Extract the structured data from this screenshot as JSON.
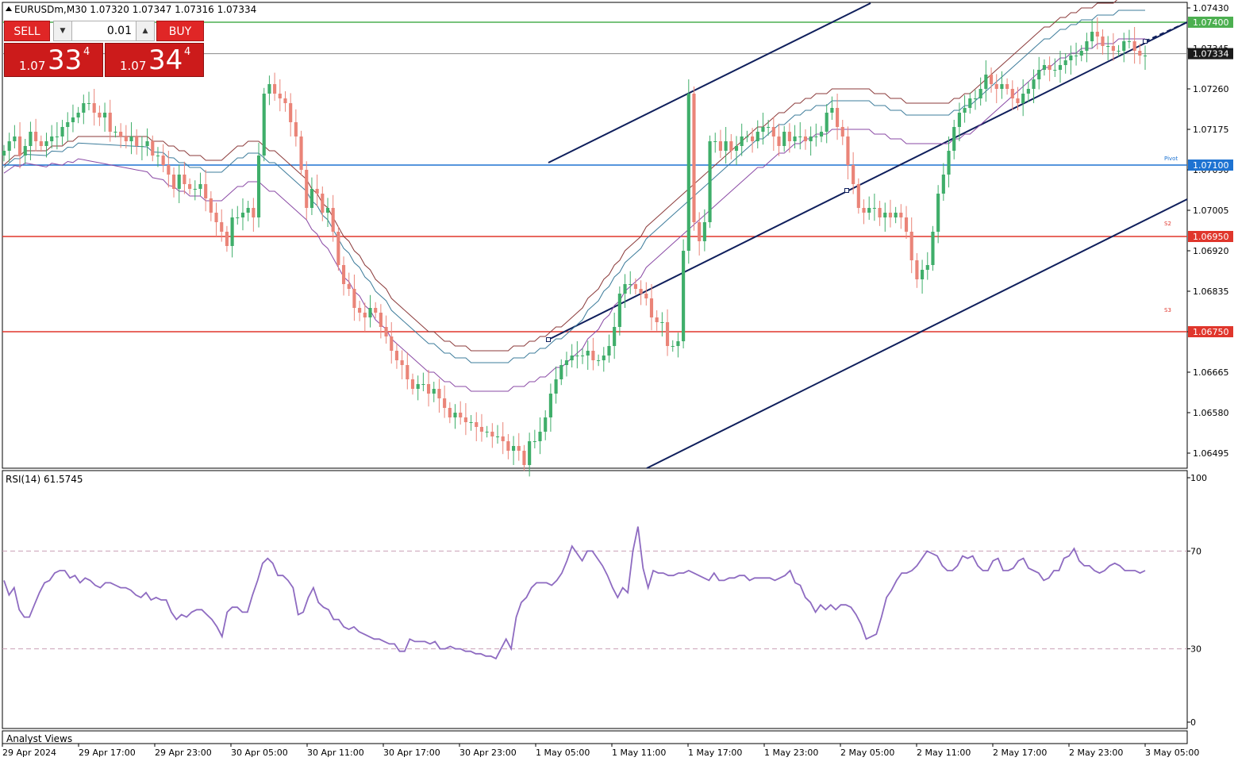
{
  "header": {
    "symbol_info": "EURUSDm,M30  1.07320 1.07347 1.07316 1.07334"
  },
  "trade_panel": {
    "sell_label": "SELL",
    "buy_label": "BUY",
    "lot": "0.01",
    "bid_prefix": "1.07",
    "bid_big": "33",
    "bid_sup": "4",
    "ask_prefix": "1.07",
    "ask_big": "34",
    "ask_sup": "4"
  },
  "price_axis": {
    "ticks": [
      "1.07430",
      "1.07345",
      "1.07260",
      "1.07175",
      "1.07090",
      "1.07005",
      "1.06920",
      "1.06835",
      "1.06750",
      "1.06665",
      "1.06580",
      "1.06495"
    ],
    "ylim": [
      1.06465,
      1.0744
    ],
    "current_price": "1.07334"
  },
  "levels": [
    {
      "value": 1.074,
      "label": "1.07400",
      "color": "#4caf50"
    },
    {
      "value": 1.071,
      "label": "1.07100",
      "color": "#1e73d2"
    },
    {
      "value": 1.0695,
      "label": "1.06950",
      "color": "#e0362c"
    },
    {
      "value": 1.0675,
      "label": "1.06750",
      "color": "#e0362c"
    }
  ],
  "level_tags": {
    "pivot": "Pivot",
    "s2": "S2",
    "s3": "S3"
  },
  "rsi": {
    "label": "RSI(14) 61.5745",
    "ticks": [
      "100",
      "70",
      "30",
      "0"
    ],
    "levels": [
      70,
      30
    ],
    "values": [
      58,
      52,
      55,
      46,
      43,
      43,
      48,
      53,
      57,
      58,
      61,
      62,
      62,
      59,
      60,
      57,
      59,
      58,
      56,
      55,
      57,
      57,
      56,
      55,
      55,
      54,
      52,
      51,
      53,
      50,
      51,
      50,
      50,
      45,
      42,
      44,
      43,
      45,
      46,
      46,
      44,
      42,
      39,
      35,
      45,
      47,
      47,
      45,
      45,
      52,
      58,
      65,
      67,
      65,
      60,
      60,
      58,
      55,
      44,
      45,
      51,
      55,
      49,
      47,
      46,
      42,
      42,
      39,
      38,
      39,
      37,
      36,
      35,
      34,
      34,
      33,
      32,
      32,
      29,
      29,
      34,
      33,
      33,
      33,
      32,
      33,
      30,
      30,
      31,
      30,
      30,
      29,
      29,
      28,
      28,
      27,
      27,
      26,
      30,
      34,
      30,
      43,
      49,
      51,
      55,
      57,
      57,
      57,
      56,
      58,
      61,
      66,
      72,
      69,
      66,
      70,
      70,
      67,
      64,
      60,
      55,
      51,
      55,
      53,
      70,
      80,
      63,
      55,
      62,
      61,
      61,
      60,
      60,
      61,
      61,
      62,
      61,
      60,
      59,
      58,
      61,
      58,
      58,
      59,
      59,
      60,
      60,
      58,
      59,
      59,
      59,
      59,
      58,
      59,
      60,
      62,
      57,
      56,
      51,
      49,
      45,
      48,
      46,
      48,
      46,
      48,
      48,
      47,
      44,
      40,
      34,
      35,
      36,
      43,
      51,
      54,
      58,
      61,
      61,
      62,
      64,
      67,
      70,
      69,
      68,
      64,
      62,
      62,
      64,
      68,
      67,
      68,
      64,
      62,
      62,
      66,
      67,
      62,
      62,
      63,
      66,
      67,
      63,
      62,
      61,
      58,
      59,
      62,
      62,
      67,
      68,
      71,
      66,
      64,
      64,
      62,
      61,
      62,
      64,
      65,
      64,
      62,
      62,
      62,
      61,
      62
    ]
  },
  "chart_data": {
    "type": "candlestick",
    "title": "EURUSDm,M30  1.07320 1.07347 1.07316 1.07334",
    "xlabel": "",
    "ylabel": "",
    "x_ticks": [
      "29 Apr 2024",
      "29 Apr 17:00",
      "29 Apr 23:00",
      "30 Apr 05:00",
      "30 Apr 11:00",
      "30 Apr 17:00",
      "30 Apr 23:00",
      "1 May 05:00",
      "1 May 11:00",
      "1 May 17:00",
      "1 May 23:00",
      "2 May 05:00",
      "2 May 11:00",
      "2 May 17:00",
      "2 May 23:00",
      "3 May 05:00"
    ],
    "ylim": [
      1.06465,
      1.0744
    ],
    "close": [
      1.0713,
      1.0715,
      1.0716,
      1.0712,
      1.0714,
      1.0717,
      1.0715,
      1.0714,
      1.0715,
      1.0716,
      1.0716,
      1.0718,
      1.0719,
      1.072,
      1.0721,
      1.0723,
      1.0723,
      1.0721,
      1.072,
      1.0721,
      1.0717,
      1.0717,
      1.0716,
      1.0715,
      1.0716,
      1.0714,
      1.0714,
      1.0715,
      1.0712,
      1.0712,
      1.071,
      1.0708,
      1.0705,
      1.0708,
      1.0706,
      1.0705,
      1.0705,
      1.0706,
      1.0703,
      1.07,
      1.0698,
      1.0696,
      1.0693,
      1.0699,
      1.0699,
      1.07,
      1.0701,
      1.0699,
      1.0712,
      1.0725,
      1.0727,
      1.0725,
      1.0724,
      1.0723,
      1.0719,
      1.0716,
      1.0709,
      1.0701,
      1.0705,
      1.0704,
      1.07,
      1.0701,
      1.0696,
      1.0689,
      1.0685,
      1.0684,
      1.068,
      1.0679,
      1.0678,
      1.068,
      1.0679,
      1.0676,
      1.0674,
      1.0671,
      1.0669,
      1.0668,
      1.0665,
      1.0663,
      1.0664,
      1.0664,
      1.0662,
      1.0663,
      1.0661,
      1.0659,
      1.0657,
      1.0658,
      1.0657,
      1.0656,
      1.0656,
      1.0655,
      1.0654,
      1.0654,
      1.0653,
      1.0653,
      1.0652,
      1.065,
      1.0651,
      1.065,
      1.0647,
      1.0652,
      1.0652,
      1.0654,
      1.0657,
      1.0662,
      1.0665,
      1.0668,
      1.0669,
      1.067,
      1.067,
      1.067,
      1.0671,
      1.0669,
      1.0669,
      1.067,
      1.0672,
      1.0676,
      1.0683,
      1.0685,
      1.0685,
      1.0684,
      1.0683,
      1.0682,
      1.0678,
      1.0677,
      1.0677,
      1.0672,
      1.0672,
      1.0673,
      1.0692,
      1.0725,
      1.0698,
      1.0694,
      1.0698,
      1.0715,
      1.0715,
      1.0713,
      1.0715,
      1.0713,
      1.0714,
      1.0716,
      1.0716,
      1.0715,
      1.0717,
      1.0718,
      1.0718,
      1.0716,
      1.0714,
      1.0717,
      1.0715,
      1.0716,
      1.0716,
      1.0715,
      1.0716,
      1.0716,
      1.0717,
      1.0721,
      1.0722,
      1.0718,
      1.0716,
      1.071,
      1.0706,
      1.0701,
      1.07,
      1.0701,
      1.0701,
      1.0699,
      1.07,
      1.0699,
      1.07,
      1.0699,
      1.0696,
      1.069,
      1.0686,
      1.0688,
      1.0689,
      1.0696,
      1.0704,
      1.0708,
      1.0713,
      1.0718,
      1.0721,
      1.0722,
      1.0724,
      1.0724,
      1.0726,
      1.0729,
      1.0727,
      1.0726,
      1.0727,
      1.0726,
      1.0724,
      1.0723,
      1.0725,
      1.0726,
      1.0728,
      1.073,
      1.0731,
      1.073,
      1.073,
      1.0731,
      1.0732,
      1.0733,
      1.0733,
      1.0734,
      1.0736,
      1.0738,
      1.0737,
      1.0735,
      1.0735,
      1.0734,
      1.0734,
      1.0736,
      1.0736,
      1.0734,
      1.0733,
      1.0733
    ],
    "moving_averages": [
      {
        "color": "#8b3a3a",
        "values": [
          1.071,
          1.0711,
          1.0712,
          1.0712,
          1.0713,
          1.0713,
          1.0713,
          1.0713,
          1.0713,
          1.0714,
          1.0714,
          1.0714,
          1.0715,
          1.0715,
          1.0716,
          1.0716,
          1.0716,
          1.0716,
          1.0716,
          1.0716,
          1.0716,
          1.0716,
          1.0716,
          1.0716,
          1.0716,
          1.0716,
          1.0716,
          1.0716,
          1.0715,
          1.0715,
          1.0715,
          1.0714,
          1.0714,
          1.0713,
          1.0713,
          1.0712,
          1.0712,
          1.0712,
          1.0711,
          1.0711,
          1.0711,
          1.0711,
          1.0712,
          1.0713,
          1.0714,
          1.0714,
          1.0715,
          1.0715,
          1.0715,
          1.0714,
          1.0713,
          1.0713,
          1.0712,
          1.0711,
          1.071,
          1.0709,
          1.0708,
          1.0707,
          1.0705,
          1.0704,
          1.0702,
          1.0701,
          1.0699,
          1.0697,
          1.0695,
          1.0694,
          1.0692,
          1.0691,
          1.0689,
          1.0688,
          1.0686,
          1.0685,
          1.0684,
          1.0682,
          1.0681,
          1.068,
          1.0679,
          1.0678,
          1.0677,
          1.0676,
          1.0675,
          1.0675,
          1.0674,
          1.0673,
          1.0673,
          1.0672,
          1.0672,
          1.0672,
          1.0671,
          1.0671,
          1.0671,
          1.0671,
          1.0671,
          1.0671,
          1.0671,
          1.0671,
          1.0672,
          1.0672,
          1.0672,
          1.0673,
          1.0673,
          1.0674,
          1.0674,
          1.0675,
          1.0676,
          1.0676,
          1.0677,
          1.0678,
          1.0679,
          1.068,
          1.0682,
          1.0683,
          1.0684,
          1.0686,
          1.0687,
          1.0689,
          1.069,
          1.0692,
          1.0693,
          1.0694,
          1.0695,
          1.0697,
          1.0698,
          1.0699,
          1.07,
          1.0701,
          1.0702,
          1.0703,
          1.0704,
          1.0705,
          1.0706,
          1.0707,
          1.0708,
          1.0709,
          1.071,
          1.0711,
          1.0712,
          1.0713,
          1.0714,
          1.0715,
          1.0716,
          1.0717,
          1.0718,
          1.0718,
          1.0719,
          1.072,
          1.0721,
          1.0721,
          1.0722,
          1.0723,
          1.0723,
          1.0724,
          1.0724,
          1.0725,
          1.0725,
          1.0725,
          1.0726,
          1.0726,
          1.0726,
          1.0726,
          1.0726,
          1.0726,
          1.0726,
          1.0726,
          1.0725,
          1.0725,
          1.0725,
          1.0724,
          1.0724,
          1.0724,
          1.0723,
          1.0723,
          1.0723,
          1.0723,
          1.0723,
          1.0723,
          1.0723,
          1.0723,
          1.0723,
          1.0724,
          1.0724,
          1.0725,
          1.0725,
          1.0726,
          1.0727,
          1.0728,
          1.0729,
          1.073,
          1.0731,
          1.0732,
          1.0733,
          1.0734,
          1.0735,
          1.0736,
          1.0737,
          1.0738,
          1.0739,
          1.0739,
          1.074,
          1.0741,
          1.0741,
          1.0742,
          1.0742,
          1.0743,
          1.0743,
          1.0743,
          1.0744,
          1.0744,
          1.0744,
          1.0744,
          1.0745,
          1.0745,
          1.0745,
          1.0745,
          1.0745,
          1.0745
        ]
      }
    ]
  },
  "footer": {
    "tab_label": "Analyst Views"
  }
}
